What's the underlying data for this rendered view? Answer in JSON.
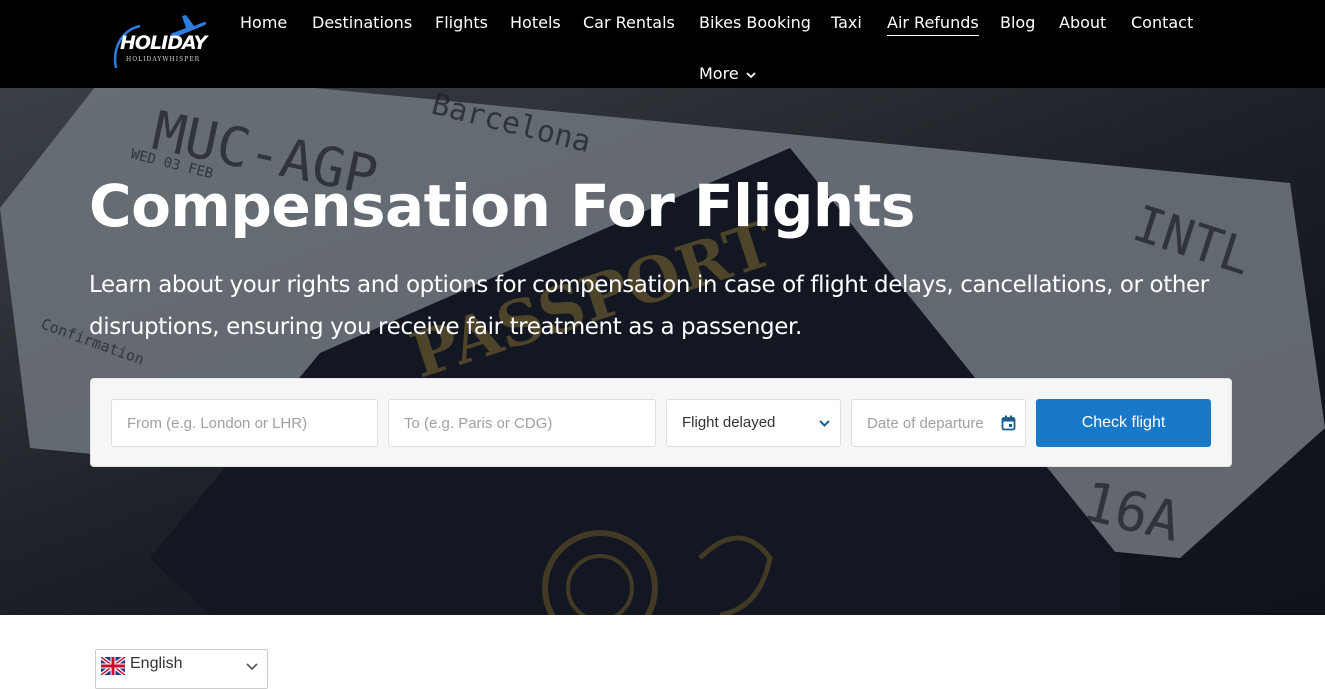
{
  "header": {
    "logo_text": "HOLIDAY",
    "logo_subtext": "HOLIDAYWHISPER",
    "nav": [
      {
        "label": "Home",
        "active": false
      },
      {
        "label": "Destinations",
        "active": false
      },
      {
        "label": "Flights",
        "active": false
      },
      {
        "label": "Hotels",
        "active": false
      },
      {
        "label": "Car Rentals",
        "active": false
      },
      {
        "label": "Bikes Booking",
        "active": false
      },
      {
        "label": "Taxi",
        "active": false
      },
      {
        "label": "Air Refunds",
        "active": true
      },
      {
        "label": "Blog",
        "active": false
      },
      {
        "label": "About",
        "active": false
      },
      {
        "label": "Contact",
        "active": false
      }
    ],
    "more_label": "More"
  },
  "hero": {
    "title": "Compensation For Flights",
    "description": "Learn about your rights and options for compensation in case of flight delays, cancellations, or other disruptions, ensuring you receive fair treatment as a passenger.",
    "background_icons": [
      "boarding-pass",
      "passport"
    ]
  },
  "search": {
    "from_placeholder": "From (e.g. London or LHR)",
    "from_value": "",
    "to_placeholder": "To (e.g. Paris or CDG)",
    "to_value": "",
    "issue_selected": "Flight delayed",
    "date_placeholder": "Date of departure",
    "date_value": "",
    "submit_label": "Check flight"
  },
  "language": {
    "label": "English",
    "flag_icon": "uk-flag-icon"
  },
  "colors": {
    "header_bg": "#000000",
    "primary_button": "#1878c9",
    "date_icon": "#1a5f8f"
  }
}
